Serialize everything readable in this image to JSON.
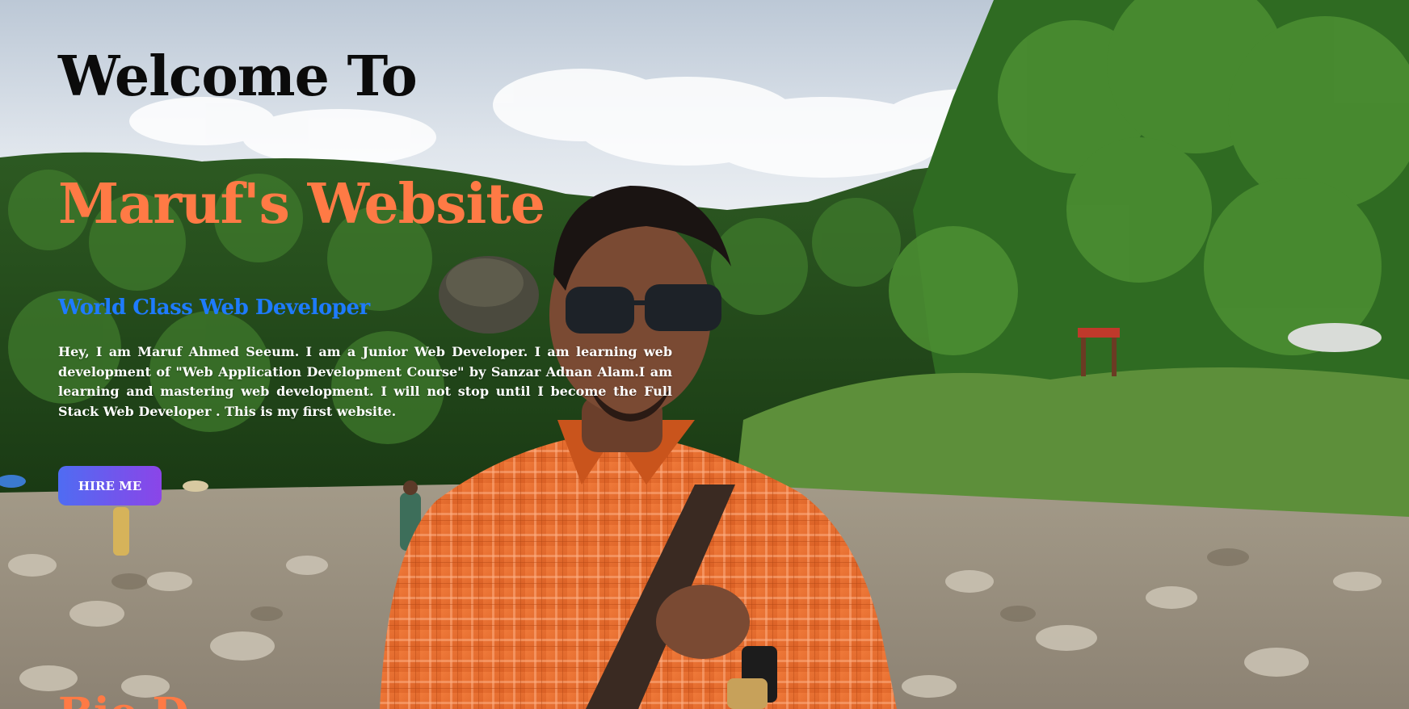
{
  "hero": {
    "welcome_text": "Welcome To",
    "site_name": "Maruf's Website",
    "tagline": "World Class Web Developer",
    "intro": "Hey, I am Maruf Ahmed Seeum. I am a Junior Web Developer. I am learning web development of \"Web Application Development Course\" by Sanzar Adnan Alam.I am learning and mastering web development. I will not stop until I become the Full Stack Web Developer . This is my first website.",
    "hire_button_label": "HIRE ME",
    "next_section_title": "Bio D"
  },
  "colors": {
    "heading_dark": "#0b0b0b",
    "accent_orange": "#ff7a45",
    "accent_blue": "#1e7bff",
    "button_gradient_start": "#4f6cf2",
    "button_gradient_end": "#8b45e8",
    "intro_text": "#ffffff"
  },
  "background_image": "photo-of-man-in-orange-plaid-shirt-at-rocky-riverbed-with-forested-hills"
}
